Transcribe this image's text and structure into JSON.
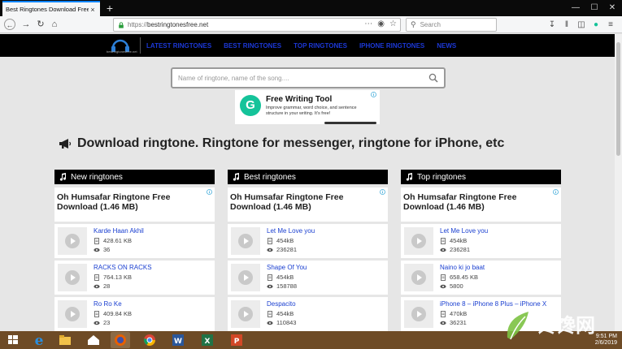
{
  "browser": {
    "tab_title": "Best Ringtones Download Free",
    "tab_close": "×",
    "new_tab": "+",
    "url_scheme": "https://",
    "url_host": "bestringtonesfree.net",
    "search_placeholder": "Search",
    "win_minimize": "—",
    "win_maximize": "☐",
    "win_close": "✕"
  },
  "site": {
    "logo_text": "bestringtonesfree.net",
    "menu": [
      "LATEST RINGTONES",
      "BEST RINGTONES",
      "TOP RINGTONES",
      "IPHONE RINGTONES",
      "NEWS"
    ],
    "search_placeholder": "Name of ringtone, name of the song....",
    "heading": "Download ringtone. Ringtone for messenger, ringtone for iPhone, etc"
  },
  "ad": {
    "title": "Free Writing Tool",
    "description": "Improve grammar, word choice, and sentence structure in your writing. It's free!",
    "logo_letter": "G"
  },
  "columns": [
    {
      "header": "New ringtones",
      "ad_title": "Oh Humsafar Ringtone Free Download (1.46 MB)",
      "songs": [
        {
          "title": "Karde Haan Akhil",
          "size": "428.61 KB",
          "views": "36"
        },
        {
          "title": "RACKS ON RACKS",
          "size": "764.13 KB",
          "views": "28"
        },
        {
          "title": "Ro Ro Ke",
          "size": "409.84 KB",
          "views": "23"
        }
      ]
    },
    {
      "header": "Best ringtones",
      "ad_title": "Oh Humsafar Ringtone Free Download (1.46 MB)",
      "songs": [
        {
          "title": "Let Me Love you",
          "size": "454kB",
          "views": "236281"
        },
        {
          "title": "Shape Of You",
          "size": "454kB",
          "views": "158788"
        },
        {
          "title": "Despacito",
          "size": "454kB",
          "views": "110843"
        }
      ]
    },
    {
      "header": "Top ringtones",
      "ad_title": "Oh Humsafar Ringtone Free Download (1.46 MB)",
      "songs": [
        {
          "title": "Let Me Love you",
          "size": "454kB",
          "views": "236281"
        },
        {
          "title": "Naino ki jo baat",
          "size": "658.45 KB",
          "views": "5800"
        },
        {
          "title": "iPhone 8 – iPhone 8 Plus – iPhone X",
          "size": "470kB",
          "views": "36231"
        }
      ]
    }
  ],
  "taskbar": {
    "time": "9:51 PM",
    "date": "2/6/2019",
    "watermark": "馋馋网"
  },
  "colors": {
    "accent_link": "#1a3fd0",
    "header_bg": "#000000",
    "page_bg": "#e6e6e6",
    "taskbar_bg": "#6e4b26"
  },
  "icons": {
    "tab_close": "close-icon",
    "nav_back": "back-arrow-icon",
    "nav_forward": "forward-arrow-icon",
    "reload": "reload-icon",
    "home": "home-icon",
    "lock": "lock-icon",
    "search": "search-icon",
    "megaphone": "megaphone-icon",
    "note": "music-note-icon",
    "play": "play-icon",
    "file": "file-icon",
    "eye": "eye-icon"
  }
}
